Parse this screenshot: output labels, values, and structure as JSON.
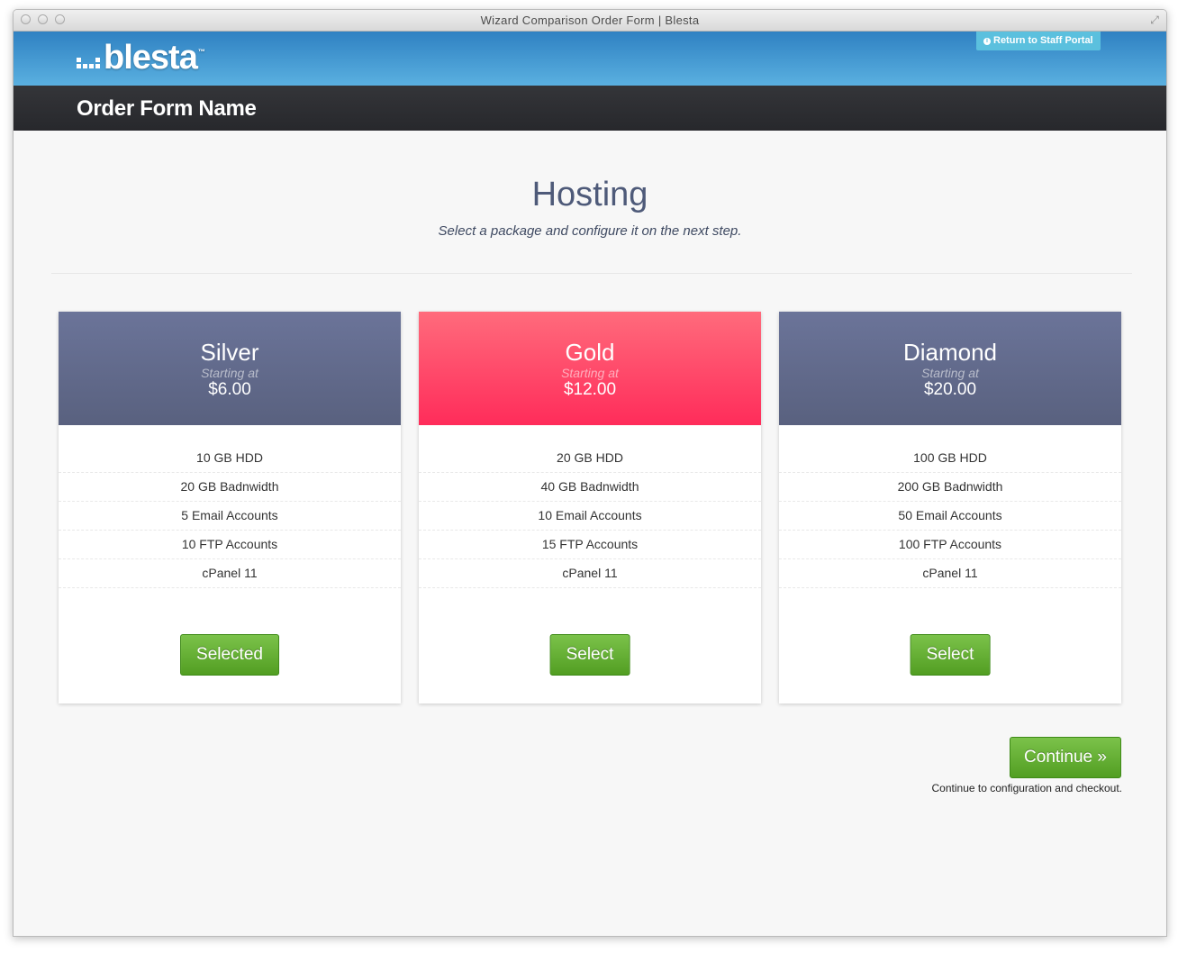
{
  "window": {
    "title": "Wizard Comparison Order Form | Blesta"
  },
  "header": {
    "logo_text": "blesta",
    "logo_tm": "™",
    "staff_portal_label": "Return to Staff Portal"
  },
  "form": {
    "name": "Order Form Name"
  },
  "hero": {
    "title": "Hosting",
    "subtitle": "Select a package and configure it on the next step."
  },
  "plans": [
    {
      "name": "Silver",
      "starting_label": "Starting at",
      "price": "$6.00",
      "features": [
        "10 GB HDD",
        "20 GB Badnwidth",
        "5 Email Accounts",
        "10 FTP Accounts",
        "cPanel 11"
      ],
      "button": "Selected"
    },
    {
      "name": "Gold",
      "starting_label": "Starting at",
      "price": "$12.00",
      "features": [
        "20 GB HDD",
        "40 GB Badnwidth",
        "10 Email Accounts",
        "15 FTP Accounts",
        "cPanel 11"
      ],
      "button": "Select"
    },
    {
      "name": "Diamond",
      "starting_label": "Starting at",
      "price": "$20.00",
      "features": [
        "100 GB HDD",
        "200 GB Badnwidth",
        "50 Email Accounts",
        "100 FTP Accounts",
        "cPanel 11"
      ],
      "button": "Select"
    }
  ],
  "footer": {
    "continue_label": "Continue »",
    "continue_note": "Continue to configuration and checkout."
  },
  "colors": {
    "header_blue": "#3a8fcc",
    "plan_standard": "#636b8c",
    "plan_featured": "#ff3d65",
    "button_green": "#62ab32",
    "info_button": "#5bc0de"
  },
  "icons": {
    "window_resize": "fullscreen-icon",
    "info": "info-icon"
  }
}
